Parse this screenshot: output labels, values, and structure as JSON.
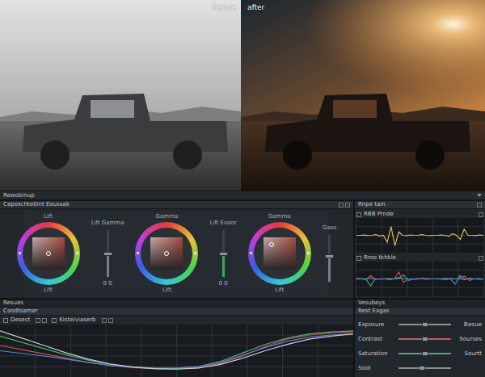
{
  "viewer": {
    "before_label": "Before",
    "after_label": "after"
  },
  "app_bar": {
    "title": "Rewobinup"
  },
  "wheels_panel": {
    "title": "Ceposchtotlint Eoussak",
    "wheels": [
      {
        "top_label": "Lift",
        "bottom_label": "Lift",
        "puck_x": 0,
        "puck_y": 0
      },
      {
        "top_label": "Gamma",
        "bottom_label": "Lift",
        "puck_x": 0,
        "puck_y": 0
      },
      {
        "top_label": "Gamma",
        "bottom_label": "Lift",
        "puck_x": -0.3,
        "puck_y": -0.35
      }
    ],
    "sliders": [
      {
        "label": "Lift Gamma",
        "reading": "0 0",
        "level": 0.5,
        "color": "#8a9096"
      },
      {
        "label": "Lift Eooor",
        "reading": "0 0",
        "level": 0.5,
        "color": "#3fbf5f"
      },
      {
        "label": "Gaso",
        "level": 0.55,
        "color": "#8a9096"
      }
    ]
  },
  "scopes_panel": {
    "title": "Rnpe tain",
    "scopes": [
      {
        "title": "RBB Prnde",
        "checked": false,
        "series": [
          {
            "color": "#d9b45a",
            "values": [
              50,
              50,
              51,
              49,
              50,
              52,
              48,
              50,
              30,
              75,
              20,
              60,
              50,
              49,
              51,
              50,
              50,
              52,
              50,
              49,
              50,
              50,
              51,
              50,
              47,
              55,
              50,
              38,
              68,
              50,
              50,
              49,
              51,
              50
            ]
          }
        ]
      },
      {
        "title": "Rroo tkhkle",
        "checked": false,
        "series": [
          {
            "color": "#d04848",
            "values": [
              52,
              50,
              48,
              60,
              50,
              50,
              51,
              49,
              50,
              70,
              40,
              50,
              50,
              49,
              52,
              50,
              50,
              51,
              50,
              48,
              50,
              50,
              52,
              58,
              45,
              50,
              50,
              49
            ]
          },
          {
            "color": "#3fae5a",
            "values": [
              50,
              51,
              50,
              30,
              50,
              49,
              50,
              51,
              50,
              55,
              50,
              50,
              49,
              50,
              50,
              51,
              50,
              50,
              49,
              50,
              51,
              50,
              50,
              48,
              52,
              50,
              49,
              50
            ]
          },
          {
            "color": "#4a7ee0",
            "values": [
              49,
              50,
              50,
              52,
              49,
              50,
              50,
              48,
              50,
              50,
              62,
              45,
              50,
              51,
              50,
              49,
              50,
              50,
              50,
              52,
              50,
              35,
              60,
              50,
              50,
              50,
              51,
              50
            ]
          }
        ]
      }
    ]
  },
  "curves_panel": {
    "section_title": "Resues",
    "title": "Coodtsamer",
    "options": [
      {
        "label": "Desect",
        "checked": false
      },
      {
        "label": "Kiste/viaserb",
        "checked": false
      }
    ],
    "series": [
      {
        "color": "#c85050",
        "values": [
          60,
          52,
          44,
          36,
          28,
          22,
          18,
          16,
          15,
          18,
          26,
          40,
          58,
          72,
          80,
          84,
          86
        ]
      },
      {
        "color": "#4fae6a",
        "values": [
          78,
          66,
          54,
          42,
          32,
          24,
          19,
          16,
          16,
          20,
          30,
          46,
          62,
          74,
          82,
          86,
          88
        ]
      },
      {
        "color": "#5a86d8",
        "values": [
          50,
          45,
          40,
          34,
          28,
          22,
          19,
          17,
          17,
          20,
          28,
          42,
          56,
          68,
          76,
          80,
          82
        ]
      },
      {
        "color": "#c8ccd0",
        "values": [
          88,
          74,
          60,
          46,
          34,
          25,
          19,
          16,
          15,
          17,
          24,
          36,
          50,
          62,
          72,
          78,
          82
        ]
      }
    ]
  },
  "adjust_panel": {
    "section_title": "Vesubeys",
    "title": "Rest Exgas",
    "sliders": [
      {
        "label": "Exposure",
        "value_label": "Beoue",
        "level": 0.5,
        "color": "#8a9096"
      },
      {
        "label": "Contrast",
        "value_label": "Sourses",
        "level": 0.5,
        "color": "#c06060"
      },
      {
        "label": "Saturation",
        "value_label": "Sourtt",
        "level": 0.5,
        "color": "#5aa0a0"
      },
      {
        "label": "Soot",
        "level": 0.45,
        "color": "#8a9096"
      }
    ]
  }
}
